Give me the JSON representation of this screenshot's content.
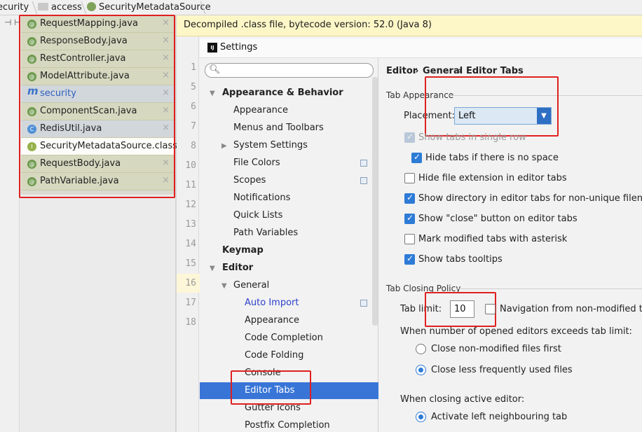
{
  "breadcrumb": {
    "items": [
      "ecurity",
      "access",
      "SecurityMetadataSource"
    ]
  },
  "toolbar": {
    "layout_glyph": "⊣ ⊢"
  },
  "tabs": [
    {
      "label": "RequestMapping.java",
      "icon": "annotation-icon",
      "state": "normal"
    },
    {
      "label": "ResponseBody.java",
      "icon": "annotation-icon",
      "state": "normal"
    },
    {
      "label": "RestController.java",
      "icon": "annotation-icon",
      "state": "normal"
    },
    {
      "label": "ModelAttribute.java",
      "icon": "annotation-icon",
      "state": "normal"
    },
    {
      "label": "security",
      "icon": "m-icon",
      "state": "blue"
    },
    {
      "label": "ComponentScan.java",
      "icon": "annotation-icon",
      "state": "normal"
    },
    {
      "label": "RedisUtil.java",
      "icon": "class-icon",
      "state": "blue"
    },
    {
      "label": "SecurityMetadataSource.class",
      "icon": "interface-icon",
      "state": "selected"
    },
    {
      "label": "RequestBody.java",
      "icon": "annotation-icon",
      "state": "normal"
    },
    {
      "label": "PathVariable.java",
      "icon": "annotation-icon",
      "state": "normal"
    }
  ],
  "tab_close_glyph": "×",
  "editor": {
    "banner": "Decompiled .class file, bytecode version: 52.0 (Java 8)",
    "line_numbers": [
      "1",
      "5",
      "6",
      "7",
      "8",
      "10",
      "11",
      "12",
      "13",
      "14",
      "15",
      "16",
      "17",
      "18"
    ]
  },
  "dialog": {
    "title": "Settings",
    "search_placeholder": "",
    "tree": [
      {
        "label": "Appearance & Behavior",
        "bold": true,
        "arrow": "▼"
      },
      {
        "label": "Appearance"
      },
      {
        "label": "Menus and Toolbars"
      },
      {
        "label": "System Settings",
        "arrow": "▶"
      },
      {
        "label": "File Colors",
        "copy": true
      },
      {
        "label": "Scopes",
        "copy": true
      },
      {
        "label": "Notifications"
      },
      {
        "label": "Quick Lists"
      },
      {
        "label": "Path Variables"
      },
      {
        "label": "Keymap",
        "bold": true
      },
      {
        "label": "Editor",
        "bold": true,
        "arrow": "▼"
      },
      {
        "label": "General",
        "arrow": "▼"
      },
      {
        "label": "Auto Import",
        "link": true,
        "copy": true
      },
      {
        "label": "Appearance"
      },
      {
        "label": "Code Completion"
      },
      {
        "label": "Code Folding"
      },
      {
        "label": "Console"
      },
      {
        "label": "Editor Tabs",
        "selected": true
      },
      {
        "label": "Gutter Icons"
      },
      {
        "label": "Postfix Completion"
      }
    ],
    "right": {
      "breadcrumb": [
        "Editor",
        "General",
        "Editor Tabs"
      ],
      "breadcrumb_sep": "›",
      "tab_appearance": {
        "title": "Tab Appearance",
        "placement_label": "Placement:",
        "placement_value": "Left",
        "checkboxes": [
          {
            "label": "Show tabs in single row",
            "checked": true,
            "disabled": true
          },
          {
            "label": "Hide tabs if there is no space",
            "checked": true
          },
          {
            "label": "Hide file extension in editor tabs",
            "checked": false
          },
          {
            "label": "Show directory in editor tabs for non-unique filenames",
            "checked": true
          },
          {
            "label": "Show \"close\" button on editor tabs",
            "checked": true
          },
          {
            "label": "Mark modified tabs with asterisk",
            "checked": false
          },
          {
            "label": "Show tabs tooltips",
            "checked": true
          }
        ]
      },
      "tab_closing": {
        "title": "Tab Closing Policy",
        "tab_limit_label": "Tab limit:",
        "tab_limit_value": "10",
        "nav_label": "Navigation from non-modified tab",
        "nav_checked": false,
        "exceeds_label": "When number of opened editors exceeds tab limit:",
        "exceed_options": [
          {
            "label": "Close non-modified files first",
            "checked": false
          },
          {
            "label": "Close less frequently used files",
            "checked": true
          }
        ],
        "active_label": "When closing active editor:",
        "active_options": [
          {
            "label": "Activate left neighbouring tab",
            "checked": true
          }
        ]
      }
    }
  },
  "colors": {
    "selection": "#3875d7",
    "annotation": "#e02020",
    "banner": "#fdf6c7"
  }
}
